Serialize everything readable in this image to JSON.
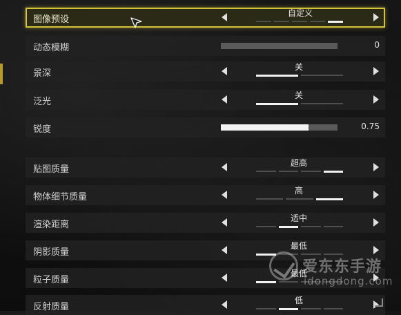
{
  "settings": [
    {
      "key": "image_preset",
      "label": "图像预设",
      "type": "option",
      "value": "自定义",
      "ticks": 5,
      "active": 4,
      "selected": true
    },
    {
      "key": "motion_blur",
      "label": "动态模糊",
      "type": "slider",
      "level": 0,
      "value_text": "0"
    },
    {
      "key": "depth_of_field",
      "label": "景深",
      "type": "option",
      "value": "关",
      "ticks": 2,
      "active": 0
    },
    {
      "key": "bloom",
      "label": "泛光",
      "type": "option",
      "value": "关",
      "ticks": 2,
      "active": 0
    },
    {
      "key": "sharpness",
      "label": "锐度",
      "type": "slider",
      "level": 0.75,
      "value_text": "0.75"
    },
    {
      "key": "texture_quality",
      "label": "贴图质量",
      "type": "option",
      "value": "超高",
      "ticks": 4,
      "active": 3
    },
    {
      "key": "object_detail_quality",
      "label": "物体细节质量",
      "type": "option",
      "value": "高",
      "ticks": 3,
      "active": 2
    },
    {
      "key": "render_distance",
      "label": "渲染距离",
      "type": "option",
      "value": "适中",
      "ticks": 4,
      "active": 1
    },
    {
      "key": "shadow_quality",
      "label": "阴影质量",
      "type": "option",
      "value": "最低",
      "ticks": 4,
      "active": 0
    },
    {
      "key": "particle_quality",
      "label": "粒子质量",
      "type": "option",
      "value": "最低",
      "ticks": 4,
      "active": 0
    },
    {
      "key": "reflection_quality",
      "label": "反射质量",
      "type": "option",
      "value": "低",
      "ticks": 4,
      "active": 1
    }
  ],
  "watermark": {
    "text_cn": "爱东东手游",
    "url": "idongdong.com"
  },
  "colors": {
    "accent": "#d4c23a",
    "row_bg": "#222222",
    "active_tick": "#f2f2f2",
    "inactive_tick": "#4e4e4e"
  }
}
